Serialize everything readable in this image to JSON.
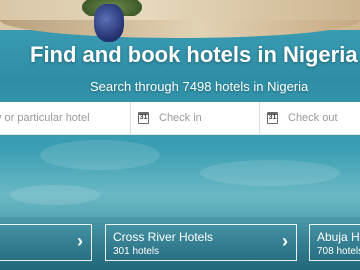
{
  "hero": {
    "title": "Find and book hotels in Nigeria",
    "subtitle": "Search through 7498 hotels in Nigeria"
  },
  "search": {
    "destination_placeholder": "y or particular hotel",
    "checkin_placeholder": "Check in",
    "checkout_placeholder": "Check out",
    "calendar_day": "31"
  },
  "cards": [
    {
      "name": "",
      "count": ""
    },
    {
      "name": "Cross River Hotels",
      "count": "301 hotels"
    },
    {
      "name": "Abuja Ho",
      "count": "708 hotels"
    }
  ],
  "chevron": "›"
}
